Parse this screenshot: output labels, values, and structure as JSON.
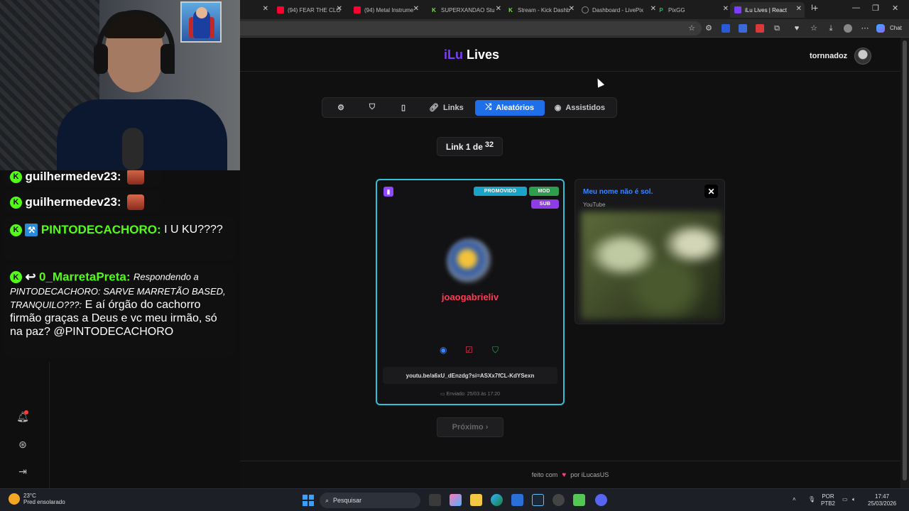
{
  "browser": {
    "tabs": [
      {
        "label": "(94) FEAR THE CLO",
        "color": "#ff0033"
      },
      {
        "label": "(94) Metal Instrume",
        "color": "#ff0033"
      },
      {
        "label": "SUPERXANDAO Stu",
        "color": "#53fc18"
      },
      {
        "label": "Stream - Kick Dashb",
        "color": "#53fc18"
      },
      {
        "label": "Dashboard - LivePix",
        "color": "#888888"
      },
      {
        "label": "PixGG",
        "color": "#1fb86a"
      },
      {
        "label": "iLu Lives | React",
        "color": "#7b3dff",
        "active": true
      }
    ],
    "chat_label": "Chat"
  },
  "overlay_chat": {
    "messages": [
      {
        "user": "guilhermedev23:",
        "user_color": "#ffffff",
        "text": ""
      },
      {
        "user": "guilhermedev23:",
        "user_color": "#ffffff",
        "text": ""
      },
      {
        "user": "PINTODECACHORO:",
        "user_color": "#53fc18",
        "text": "I U KU????"
      },
      {
        "user": "0_MarretaPreta:",
        "user_color": "#53fc18",
        "reply": "Respondendo a PINTODECACHORO: SARVE MARRETÃO BASED, TRANQUILO???:",
        "text": "E aí órgão do cachorro firmão graças a Deus e vc meu irmão, só na paz? @PINTODECACHORO"
      }
    ]
  },
  "app": {
    "brand_prefix": "iLu",
    "brand_suffix": "Lives",
    "username": "tornnadoz",
    "nav": [
      {
        "label": "",
        "icon": "gear-icon"
      },
      {
        "label": "",
        "icon": "shield-icon"
      },
      {
        "label": "",
        "icon": "bookmark-icon"
      },
      {
        "label": "Links",
        "icon": "link-icon"
      },
      {
        "label": "Aleatórios",
        "icon": "shuffle-icon",
        "active": true
      },
      {
        "label": "Assistidos",
        "icon": "eye-icon"
      }
    ],
    "counter": {
      "prefix": "Link 1 de",
      "total": "32"
    },
    "card": {
      "platform": "twitch",
      "badges": {
        "promoted": "PROMOVIDO",
        "mod": "MOD",
        "sub": "SUB"
      },
      "streamer": "joaogabrieliv",
      "link": "youtu.be/a6xU_dEnzdg?si=ASXx7fCL-KdYSexn",
      "sent": "Enviado: 25/03 às 17:20"
    },
    "side_card": {
      "title": "Meu nome não é sol.",
      "platform": "YouTube"
    },
    "next_button": "Próximo ›",
    "footer": {
      "prefix": "feito com",
      "suffix": "por iLucasUS"
    }
  },
  "taskbar": {
    "weather_temp": "23°C",
    "weather_desc": "Pred ensolarado",
    "search_placeholder": "Pesquisar",
    "lang_1": "POR",
    "lang_2": "PTB2",
    "time": "17:47",
    "date": "25/03/2026"
  }
}
